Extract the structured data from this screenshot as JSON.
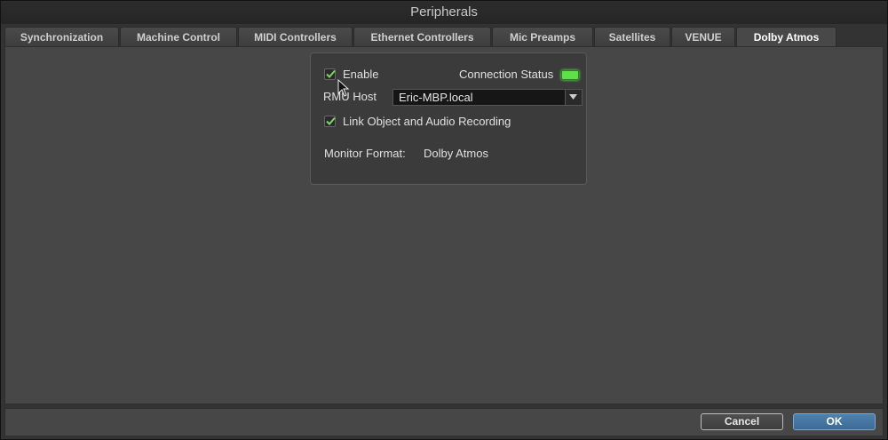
{
  "window": {
    "title": "Peripherals"
  },
  "tabs": [
    {
      "label": "Synchronization",
      "active": false
    },
    {
      "label": "Machine Control",
      "active": false
    },
    {
      "label": "MIDI Controllers",
      "active": false
    },
    {
      "label": "Ethernet Controllers",
      "active": false
    },
    {
      "label": "Mic Preamps",
      "active": false
    },
    {
      "label": "Satellites",
      "active": false
    },
    {
      "label": "VENUE",
      "active": false
    },
    {
      "label": "Dolby Atmos",
      "active": true
    }
  ],
  "panel": {
    "enable": {
      "label": "Enable",
      "checked": true
    },
    "connection_status": {
      "label": "Connection Status",
      "state": "connected",
      "color": "#5fe04a"
    },
    "rmu_host": {
      "label": "RMU Host",
      "value": "Eric-MBP.local"
    },
    "link_recording": {
      "label": "Link Object and Audio Recording",
      "checked": true
    },
    "monitor_format": {
      "label": "Monitor Format:",
      "value": "Dolby Atmos"
    }
  },
  "footer": {
    "cancel_label": "Cancel",
    "ok_label": "OK"
  },
  "icons": {
    "check": "checkmark-icon",
    "dropdown": "chevron-down-icon",
    "pointer": "mouse-pointer-icon"
  },
  "colors": {
    "accent": "#3d6b95",
    "check": "#7fd36b"
  }
}
